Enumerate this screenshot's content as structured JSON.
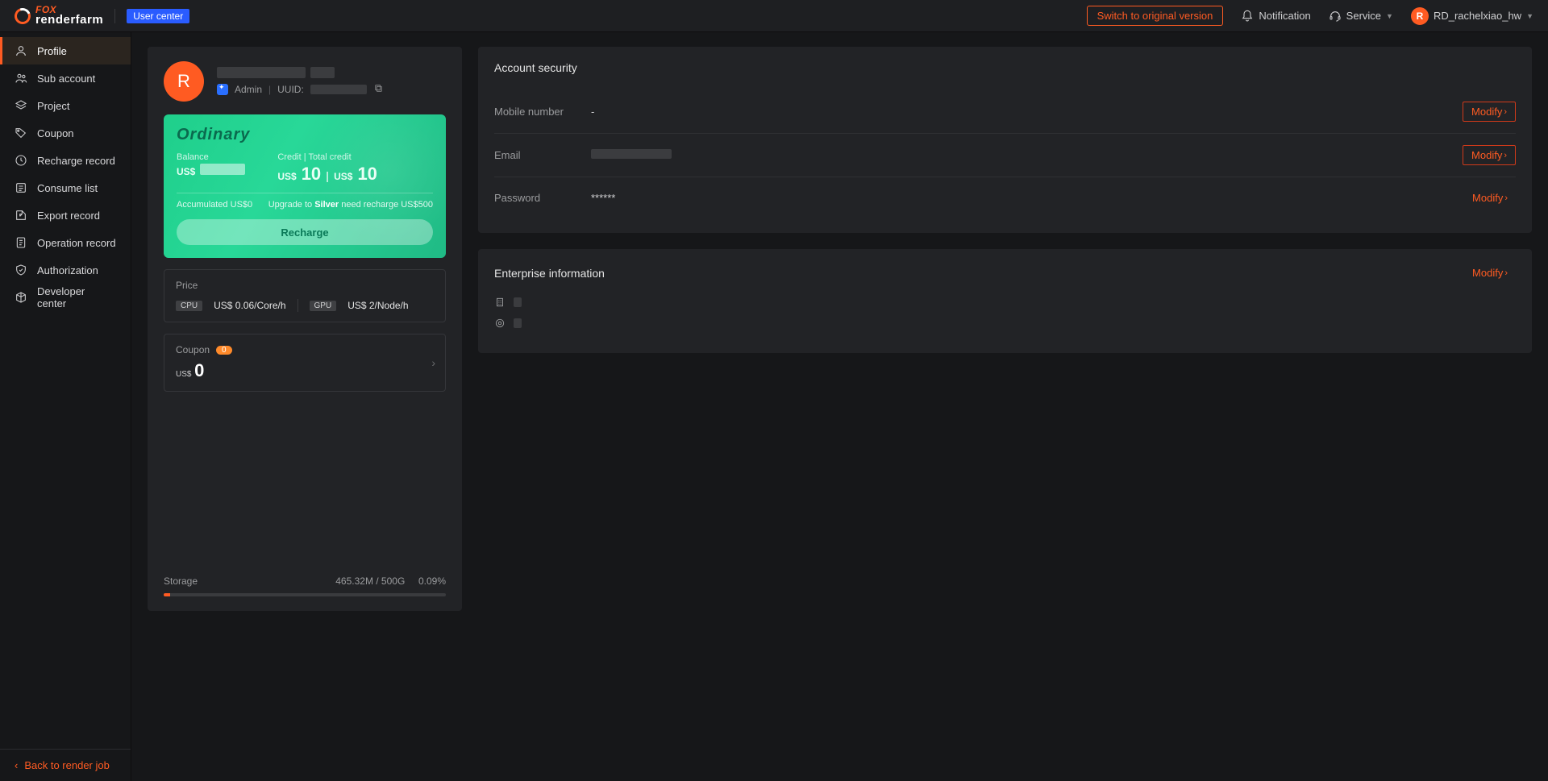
{
  "topbar": {
    "brand_top": "FOX",
    "brand_bottom": "renderfarm",
    "user_center_badge": "User center",
    "switch_label": "Switch to original version",
    "notification_label": "Notification",
    "service_label": "Service",
    "username": "RD_rachelxiao_hw",
    "avatar_initial": "R"
  },
  "sidebar": {
    "items": [
      {
        "label": "Profile",
        "active": true
      },
      {
        "label": "Sub account"
      },
      {
        "label": "Project"
      },
      {
        "label": "Coupon"
      },
      {
        "label": "Recharge record"
      },
      {
        "label": "Consume list"
      },
      {
        "label": "Export record"
      },
      {
        "label": "Operation record"
      },
      {
        "label": "Authorization"
      },
      {
        "label": "Developer center"
      }
    ],
    "back_label": "Back to render job"
  },
  "profile": {
    "avatar_initial": "R",
    "role_label": "Admin",
    "uuid_label": "UUID:",
    "tier": "Ordinary",
    "balance_label": "Balance",
    "balance_currency": "US$",
    "credit_label": "Credit | Total credit",
    "credit_currency": "US$",
    "credit_value": "10",
    "total_credit_currency": "US$",
    "total_credit_value": "10",
    "accumulated_label": "Accumulated US$0",
    "upgrade_prefix": "Upgrade to ",
    "upgrade_tier": "Silver",
    "upgrade_suffix": " need recharge US$500",
    "recharge_button": "Recharge",
    "price_title": "Price",
    "cpu_tag": "CPU",
    "cpu_price": "US$ 0.06/Core/h",
    "gpu_tag": "GPU",
    "gpu_price": "US$ 2/Node/h",
    "coupon_title": "Coupon",
    "coupon_count": "0",
    "coupon_currency": "US$",
    "coupon_value": "0",
    "storage_label": "Storage",
    "storage_usage": "465.32M / 500G",
    "storage_pct": "0.09%"
  },
  "security": {
    "title": "Account security",
    "rows": [
      {
        "label": "Mobile number",
        "value": "-",
        "modify": "Modify",
        "boxed": true
      },
      {
        "label": "Email",
        "value": "",
        "pixelated": true,
        "modify": "Modify",
        "boxed": true
      },
      {
        "label": "Password",
        "value": "******",
        "modify": "Modify",
        "boxed": false
      }
    ]
  },
  "enterprise": {
    "title": "Enterprise information",
    "modify": "Modify"
  }
}
